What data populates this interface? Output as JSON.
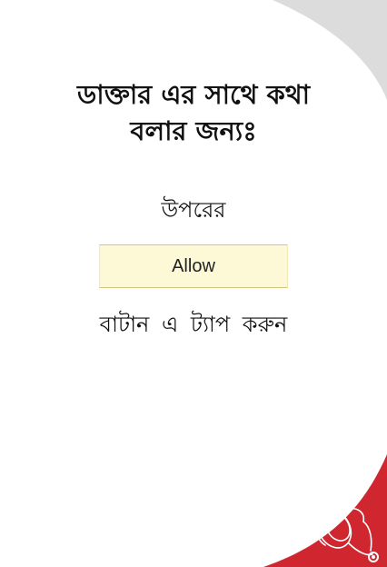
{
  "instructions": {
    "title_line1": "ডাক্তার এর সাথে কথা",
    "title_line2": "বলার জন্যঃ",
    "above_text": "উপরের",
    "tap_text": "বাটান এ ট্যাপ করুন"
  },
  "allow_button": {
    "label": "Allow"
  },
  "colors": {
    "background": "#ffffff",
    "corner_grey": "#dcdcdc",
    "corner_red": "#d0262f",
    "button_fill": "#fdf8d6",
    "button_border": "#d8c77a"
  },
  "icons": {
    "corner_logo": "stethoscope-icon"
  }
}
